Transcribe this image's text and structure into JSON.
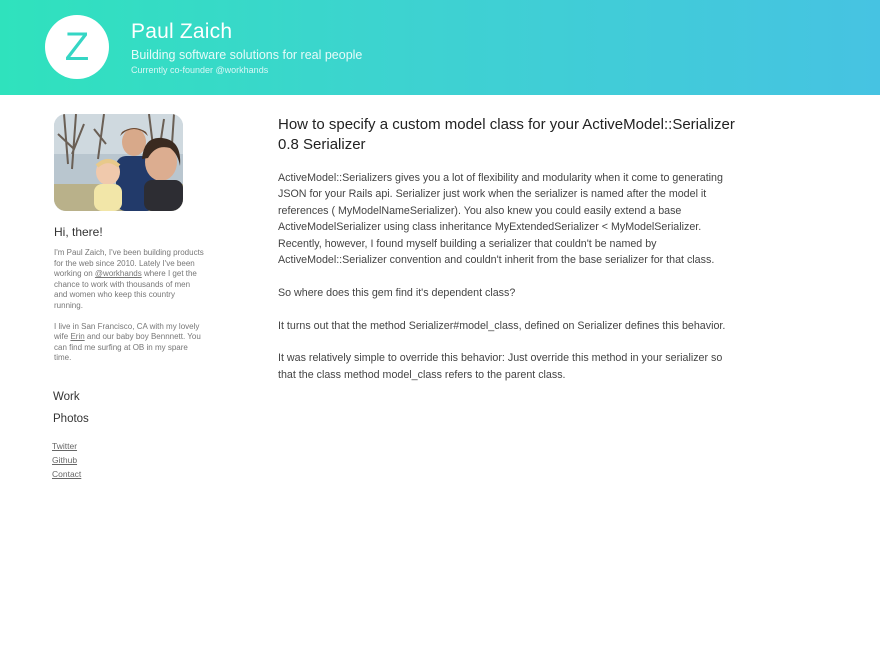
{
  "header": {
    "logo_letter": "Z",
    "title": "Paul Zaich",
    "tagline": "Building software solutions for real people",
    "subline": "Currently co-founder @workhands"
  },
  "sidebar": {
    "greeting": "Hi, there!",
    "bio_p1_a": "I'm Paul Zaich, I've been building products for the web since 2010. Lately I've been working on ",
    "bio_p1_link": "@workhands",
    "bio_p1_b": " where I get the chance to work with thousands of men and women who keep this country running.",
    "bio_p2_a": "I live in San Francisco, CA with my lovely wife ",
    "bio_p2_link": "Erin",
    "bio_p2_b": " and our baby boy Bennnett. You can find me surfing at OB in my spare time.",
    "nav": [
      "Work",
      "Photos"
    ],
    "links": [
      "Twitter",
      "Github",
      "Contact"
    ]
  },
  "post": {
    "title": "How to specify a custom model class for your ActiveModel::Serializer 0.8 Serializer",
    "paragraphs": [
      "ActiveModel::Serializers gives you a lot of flexibility and modularity when it come to generating JSON for your Rails api. Serializer just work when the serializer is named after the model it references ( MyModelNameSerializer). You also knew you could easily extend a base ActiveModelSerializer using class inheritance MyExtendedSerializer < MyModelSerializer. Recently, however, I found myself building a serializer that couldn't be named by ActiveModel::Serializer convention and couldn't inherit from the base serializer for that class.",
      "So where does this gem find it's dependent class?",
      "It turns out that the method Serializer#model_class, defined on Serializer defines this behavior.",
      "It was relatively simple to override this behavior: Just override this method in your serializer so that the class method model_class refers to the parent class."
    ]
  }
}
